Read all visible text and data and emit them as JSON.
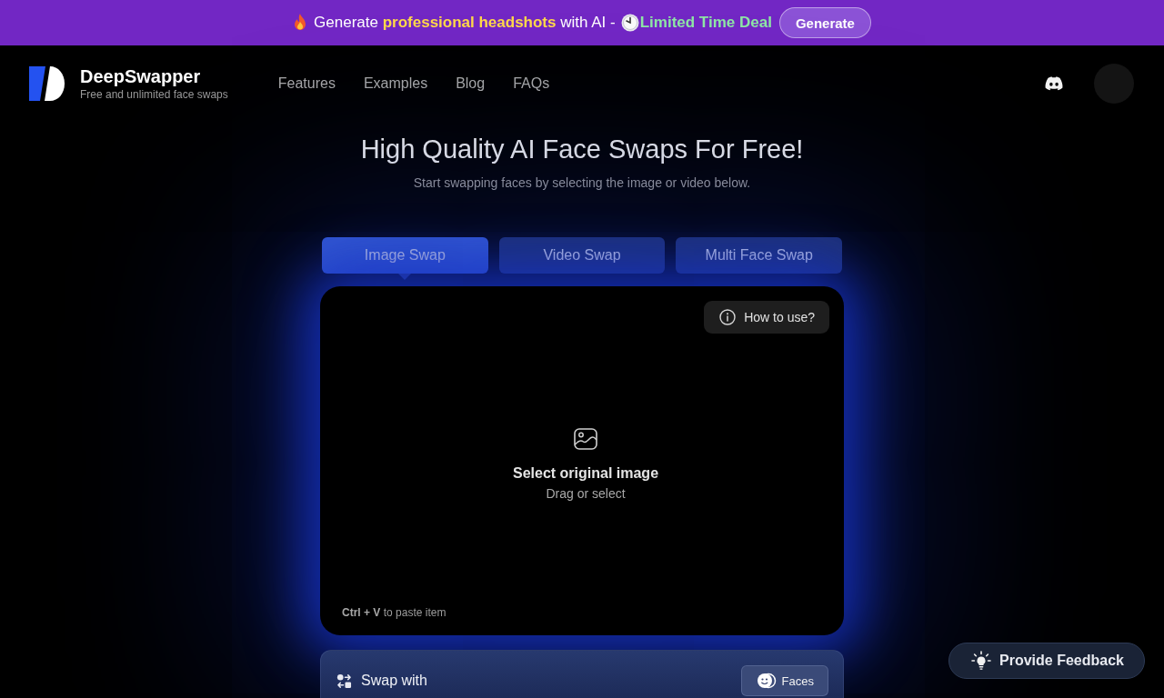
{
  "promo_banner": {
    "text": "Generate **professional headshots** with AI -",
    "deal": "Limited Time Deal",
    "button": "Generate"
  },
  "header": {
    "brand": "DeepSwapper",
    "tagline": "Free and unlimited face swaps",
    "nav": [
      "Features",
      "Examples",
      "Blog",
      "FAQs"
    ]
  },
  "hero": {
    "title": "High Quality AI Face Swaps For Free!",
    "subtitle": "Start swapping faces by selecting the image or video below."
  },
  "tabs": [
    {
      "label": "Image Swap",
      "selected": true
    },
    {
      "label": "Video Swap",
      "selected": false
    },
    {
      "label": "Multi Face Swap",
      "selected": false
    }
  ],
  "upload": {
    "help_button": "How to use?",
    "title": "Select original image",
    "hint": "Drag or select",
    "paste_hint": "**Ctrl + V** to paste item"
  },
  "swap_with": {
    "label": "Swap with",
    "button": "Faces"
  },
  "feedback_button": "Provide Feedback"
}
